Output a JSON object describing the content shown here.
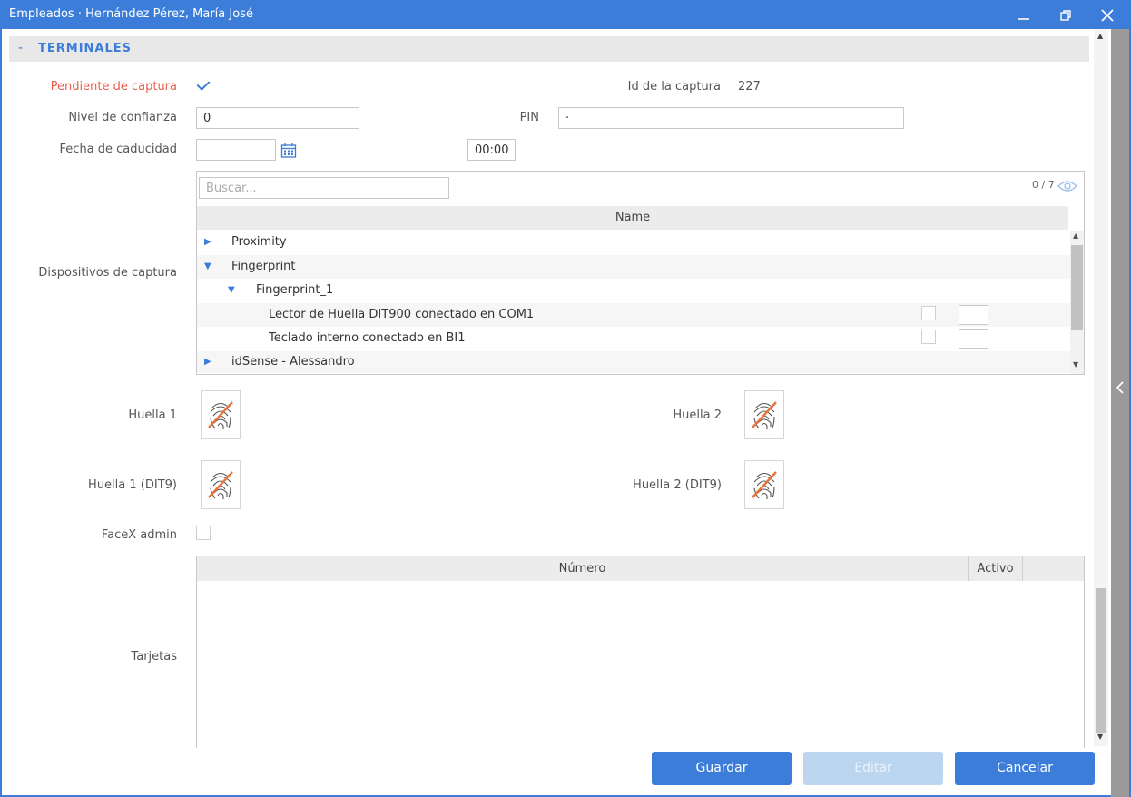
{
  "window": {
    "title": "Empleados · Hernández Pérez, María José"
  },
  "section": {
    "collapse": "-",
    "title": "TERMINALES"
  },
  "form": {
    "pending_label": "Pendiente de captura",
    "capture_id_label": "Id de la captura",
    "capture_id_value": "227",
    "confidence_label": "Nivel de confianza",
    "confidence_value": "0",
    "pin_label": "PIN",
    "pin_value": "·",
    "expiry_label": "Fecha de caducidad",
    "expiry_time": "00:00",
    "devices_label": "Dispositivos de captura",
    "fp1_label": "Huella 1",
    "fp2_label": "Huella 2",
    "fp1_dit_label": "Huella 1 (DIT9)",
    "fp2_dit_label": "Huella 2 (DIT9)",
    "facex_label": "FaceX admin",
    "cards_label": "Tarjetas"
  },
  "devices": {
    "search_placeholder": "Buscar...",
    "count": "0 / 7",
    "column_name": "Name",
    "rows": [
      {
        "label": "Proximity",
        "level": 0,
        "expanded": false
      },
      {
        "label": "Fingerprint",
        "level": 0,
        "expanded": true
      },
      {
        "label": "Fingerprint_1",
        "level": 1,
        "expanded": true
      },
      {
        "label": "Lector de Huella DIT900 conectado en COM1",
        "level": 2
      },
      {
        "label": "Teclado interno conectado en BI1",
        "level": 2
      },
      {
        "label": "idSense - Alessandro",
        "level": 0,
        "expanded": false
      }
    ]
  },
  "cards": {
    "col_number": "Número",
    "col_active": "Activo"
  },
  "buttons": {
    "save": "Guardar",
    "edit": "Editar",
    "cancel": "Cancelar"
  },
  "colors": {
    "accent": "#3b7dd8",
    "required": "#e8604c",
    "fingerprint_off": "#e8743b"
  },
  "icons": {
    "minimize": "minimize-icon",
    "restore": "restore-icon",
    "close": "close-icon",
    "calendar": "calendar-icon",
    "eye": "eye-icon",
    "fingerprint": "fingerprint-disabled-icon"
  }
}
